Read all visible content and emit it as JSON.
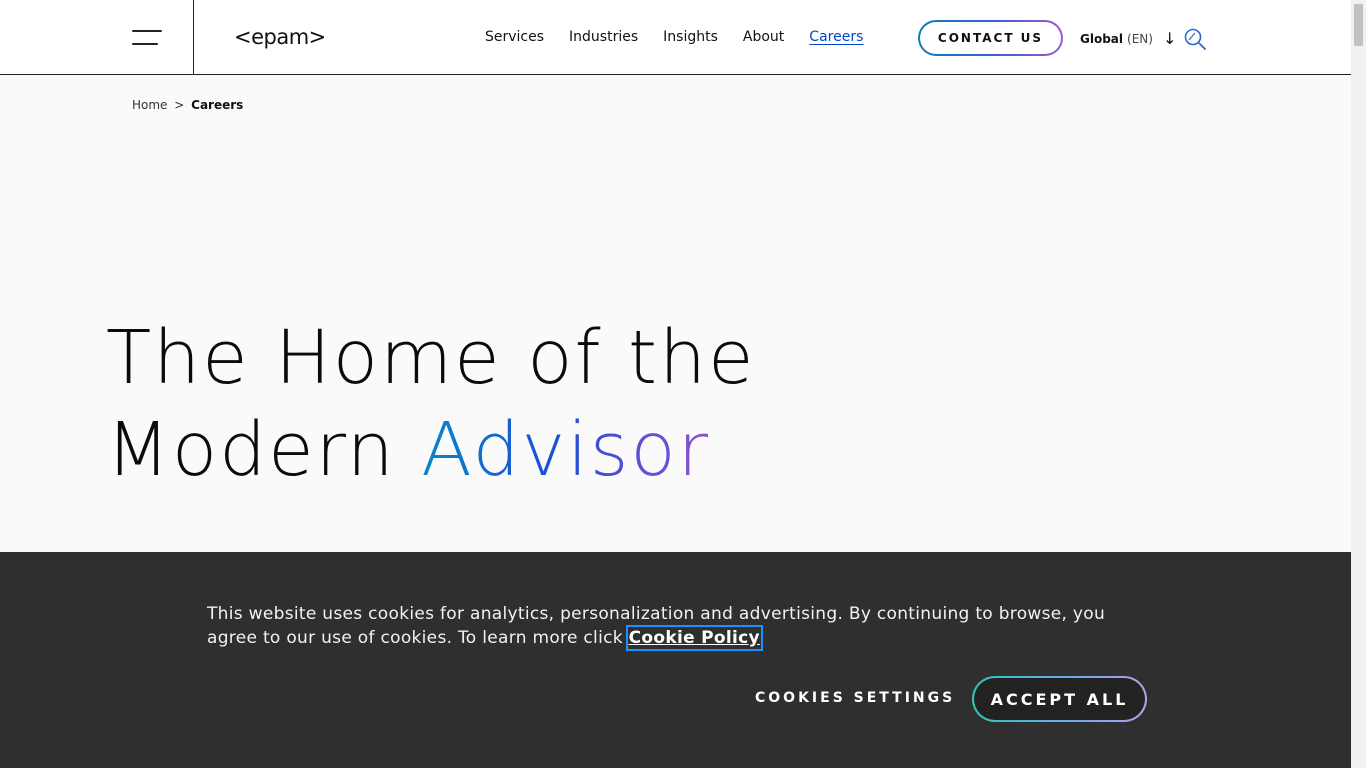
{
  "header": {
    "logo_text": "<epam>",
    "nav": [
      {
        "label": "Services"
      },
      {
        "label": "Industries"
      },
      {
        "label": "Insights"
      },
      {
        "label": "About"
      },
      {
        "label": "Careers",
        "active": true
      }
    ],
    "contact_label": "CONTACT US",
    "language": {
      "region": "Global",
      "code": "(EN)"
    }
  },
  "breadcrumb": {
    "home": "Home",
    "separator": ">",
    "current": "Careers"
  },
  "hero": {
    "line1": "The Home of the",
    "line2_plain": "Modern ",
    "line2_accent": "Advisor"
  },
  "cookie": {
    "message": "This website uses cookies for analytics, personalization and advertising. By continuing to browse, you agree to our use of cookies. To learn more click ",
    "policy_link": "Cookie Policy",
    "settings_label": "COOKIES SETTINGS",
    "accept_label": "ACCEPT ALL"
  },
  "colors": {
    "accent_blue": "#0047cc",
    "gradient_start": "#0a86c9",
    "gradient_end": "#8e50d2",
    "banner_bg": "#282828"
  }
}
